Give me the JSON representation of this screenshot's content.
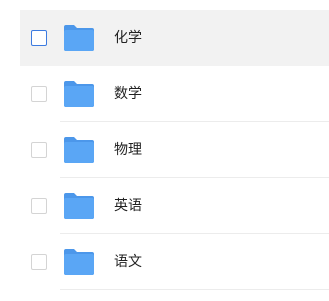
{
  "folders": [
    {
      "name": "化学",
      "selected": true,
      "icon": "folder-icon",
      "checked": false
    },
    {
      "name": "数学",
      "selected": false,
      "icon": "folder-icon",
      "checked": false
    },
    {
      "name": "物理",
      "selected": false,
      "icon": "folder-icon",
      "checked": false
    },
    {
      "name": "英语",
      "selected": false,
      "icon": "folder-icon",
      "checked": false
    },
    {
      "name": "语文",
      "selected": false,
      "icon": "folder-icon",
      "checked": false
    }
  ],
  "colors": {
    "folder": "#5aa6f5",
    "folder_tab": "#4c97ea",
    "checkbox_border": "#d4d4d4",
    "checkbox_active_border": "#3d7be0",
    "selected_row_bg": "#f2f2f2",
    "divider": "#ececec",
    "text": "#222222"
  }
}
